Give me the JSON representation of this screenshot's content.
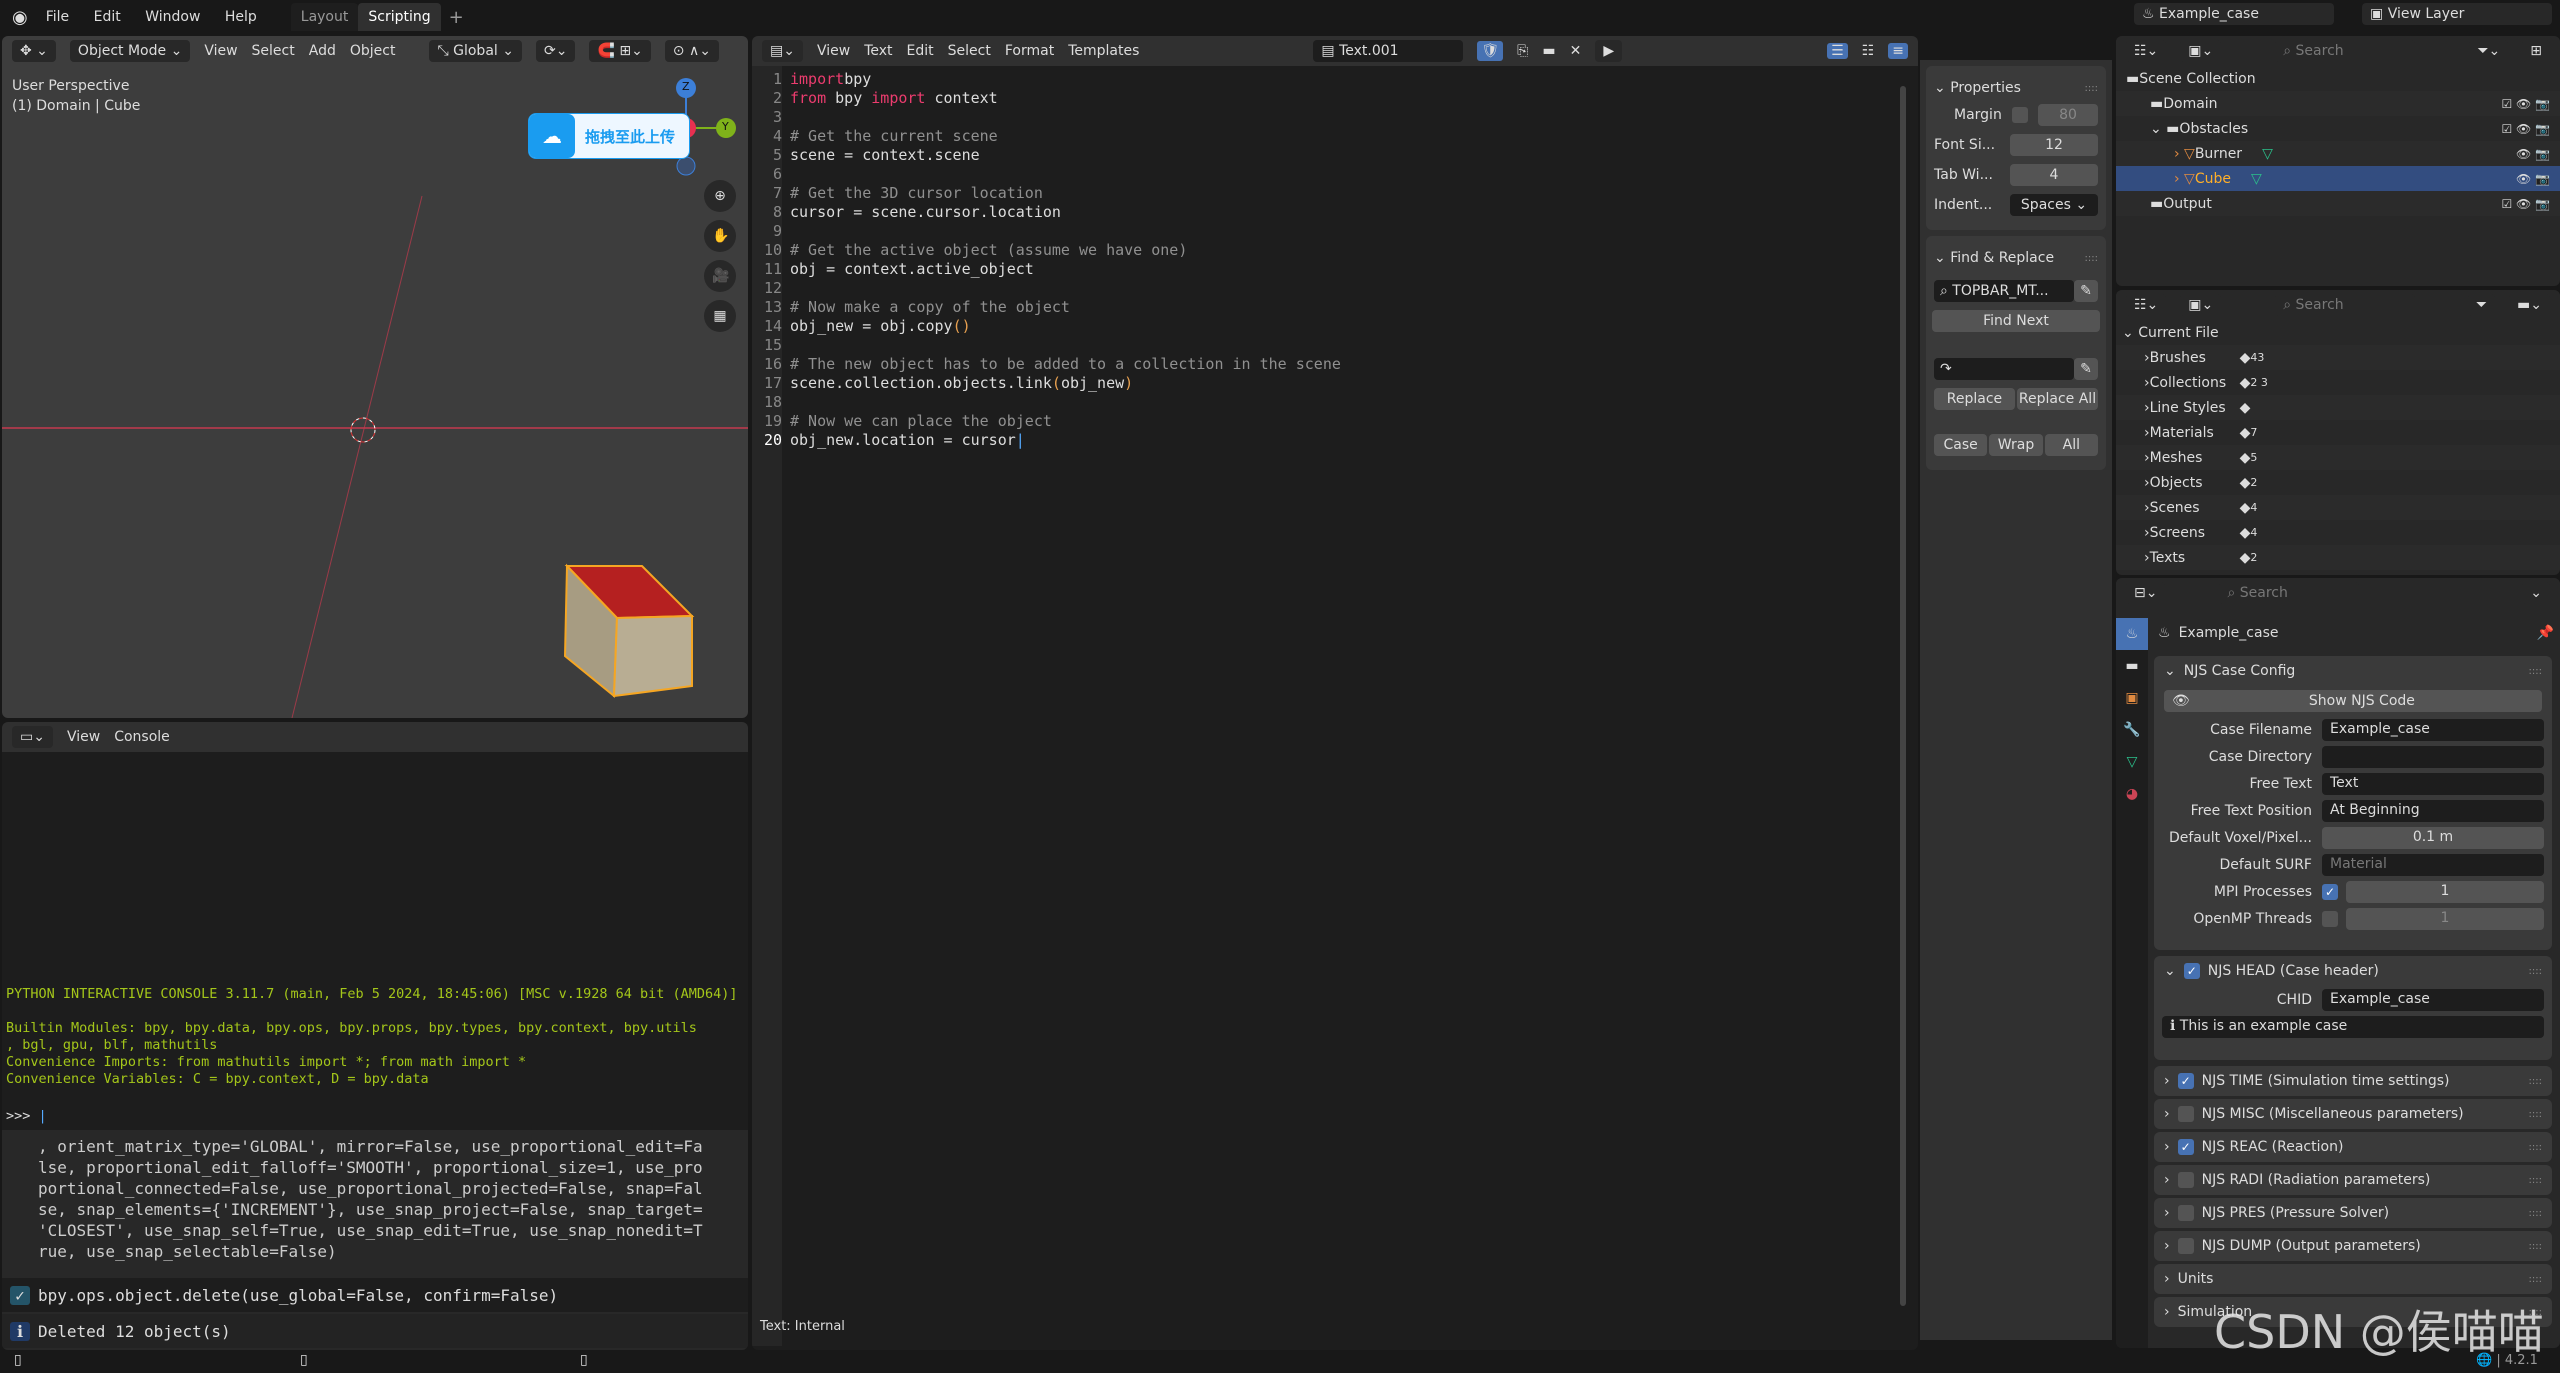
{
  "topbar": {
    "menus": [
      "File",
      "Edit",
      "Window",
      "Help"
    ],
    "tabs": [
      "Layout",
      "Scripting"
    ],
    "add": "+",
    "scene": "Example_case",
    "view_layer": "View Layer"
  },
  "viewport": {
    "mode": "Object Mode",
    "menus": [
      "View",
      "Select",
      "Add",
      "Object"
    ],
    "orientation": "Global",
    "perspective": "User Perspective",
    "context": "(1) Domain | Cube",
    "gizmo": {
      "z": "Z",
      "y": "Y"
    },
    "upload_overlay": "拖拽至此上传",
    "colors": {
      "axis_x": "#c43a4e",
      "axis_y": "#7fb21a",
      "cube_top": "#b52020",
      "cube_side": "#a79c82",
      "selection": "#f5a623"
    }
  },
  "console": {
    "menus": [
      "View",
      "Console"
    ],
    "banner": "PYTHON INTERACTIVE CONSOLE 3.11.7 (main, Feb  5 2024, 18:45:06) [MSC v.1928 64 bit (AMD64)]",
    "lines": [
      "Builtin Modules:       bpy, bpy.data, bpy.ops, bpy.props, bpy.types, bpy.context, bpy.utils",
      ", bgl, gpu, blf, mathutils",
      "Convenience Imports:   from mathutils import *; from math import *",
      "Convenience Variables: C = bpy.context, D = bpy.data"
    ],
    "prompt": ">>> ",
    "report_lines": [
      ", orient_matrix_type='GLOBAL', mirror=False, use_proportional_edit=Fa",
      "lse, proportional_edit_falloff='SMOOTH', proportional_size=1, use_pro",
      "portional_connected=False, use_proportional_projected=False, snap=Fal",
      "se, snap_elements={'INCREMENT'}, use_snap_project=False, snap_target=",
      "'CLOSEST', use_snap_self=True, use_snap_edit=True, use_snap_nonedit=T",
      "rue, use_snap_selectable=False)"
    ],
    "op": "bpy.ops.object.delete(use_global=False, confirm=False)",
    "info": "Deleted 12 object(s)"
  },
  "text_editor": {
    "menus": [
      "View",
      "Text",
      "Edit",
      "Select",
      "Format",
      "Templates"
    ],
    "text_name": "Text.001",
    "status": "Text: Internal",
    "code": [
      [
        [
          "kw",
          "import"
        ],
        [
          "",
          "bpy"
        ]
      ],
      [
        [
          "kw",
          "from"
        ],
        [
          "",
          " bpy "
        ],
        [
          "kw",
          "import"
        ],
        [
          "",
          " context"
        ]
      ],
      [],
      [
        [
          "cm",
          "# Get the current scene"
        ]
      ],
      [
        [
          "",
          "scene = context.scene"
        ]
      ],
      [],
      [
        [
          "cm",
          "# Get the 3D cursor location"
        ]
      ],
      [
        [
          "",
          "cursor = scene.cursor.location"
        ]
      ],
      [],
      [
        [
          "cm",
          "# Get the active object (assume we have one)"
        ]
      ],
      [
        [
          "",
          "obj = context.active_object"
        ]
      ],
      [],
      [
        [
          "cm",
          "# Now make a copy of the object"
        ]
      ],
      [
        [
          "",
          "obj_new = obj.copy"
        ],
        [
          "str",
          "()"
        ]
      ],
      [],
      [
        [
          "cm",
          "# The new object has to be added to a collection in the scene"
        ]
      ],
      [
        [
          "",
          "scene.collection.objects.link"
        ],
        [
          "str",
          "("
        ],
        [
          "",
          "obj_new"
        ],
        [
          "str",
          ")"
        ]
      ],
      [],
      [
        [
          "cm",
          "# Now we can place the object"
        ]
      ],
      [
        [
          "",
          "obj_new.location = cursor"
        ]
      ]
    ],
    "sidebar": {
      "properties_title": "Properties",
      "margin_label": "Margin",
      "margin": "80",
      "font_size_label": "Font Si...",
      "font_size": "12",
      "tab_width_label": "Tab Wi...",
      "tab_width": "4",
      "indent_label": "Indent...",
      "indent": "Spaces",
      "find_title": "Find & Replace",
      "find_value": "TOPBAR_MT...",
      "find_next": "Find Next",
      "replace": "Replace",
      "replace_all": "Replace All",
      "case": "Case",
      "wrap": "Wrap",
      "all": "All"
    }
  },
  "outliner": {
    "search_placeholder": "Search",
    "items": [
      {
        "name": "Scene Collection",
        "depth": 0
      },
      {
        "name": "Domain",
        "depth": 1,
        "check": true
      },
      {
        "name": "Obstacles",
        "depth": 1,
        "check": true,
        "expanded": true
      },
      {
        "name": "Burner",
        "depth": 2,
        "object": true
      },
      {
        "name": "Cube",
        "depth": 2,
        "object": true,
        "selected": true
      },
      {
        "name": "Output",
        "depth": 1,
        "check": true
      }
    ]
  },
  "blend_file": {
    "search_placeholder": "Search",
    "root": "Current File",
    "items": [
      {
        "name": "Brushes",
        "count": "43"
      },
      {
        "name": "Collections",
        "count": "2 3"
      },
      {
        "name": "Line Styles",
        "count": ""
      },
      {
        "name": "Materials",
        "count": "7"
      },
      {
        "name": "Meshes",
        "count": "5"
      },
      {
        "name": "Objects",
        "count": "2"
      },
      {
        "name": "Scenes",
        "count": "4"
      },
      {
        "name": "Screens",
        "count": "4"
      },
      {
        "name": "Texts",
        "count": "2"
      }
    ]
  },
  "properties": {
    "search_placeholder": "Search",
    "scene_name": "Example_case",
    "config_title": "NJS Case Config",
    "show_code": "Show NJS Code",
    "fields": [
      {
        "label": "Case Filename",
        "value": "Example_case"
      },
      {
        "label": "Case Directory",
        "value": ""
      },
      {
        "label": "Free Text",
        "value": "Text"
      },
      {
        "label": "Free Text Position",
        "value": "At Beginning"
      },
      {
        "label": "Default Voxel/Pixel...",
        "value": "0.1 m"
      },
      {
        "label": "Default SURF",
        "value": "Material"
      },
      {
        "label": "MPI Processes",
        "value": "1",
        "checked": true
      },
      {
        "label": "OpenMP Threads",
        "value": "1",
        "checked": false
      }
    ],
    "head": {
      "title": "NJS HEAD (Case header)",
      "checked": true,
      "chid_label": "CHID",
      "chid": "Example_case",
      "info": "This is an example case"
    },
    "sections": [
      {
        "title": "NJS TIME (Simulation time settings)",
        "checked": true
      },
      {
        "title": "NJS MISC (Miscellaneous parameters)",
        "checked": false
      },
      {
        "title": "NJS REAC (Reaction)",
        "checked": true
      },
      {
        "title": "NJS RADI (Radiation parameters)",
        "checked": false
      },
      {
        "title": "NJS PRES (Pressure Solver)",
        "checked": false
      },
      {
        "title": "NJS DUMP (Output parameters)",
        "checked": false
      }
    ],
    "other_panels": [
      "Units",
      "Simulation"
    ]
  },
  "statusbar": {
    "version": "4.2.1"
  },
  "watermark": "CSDN @侯喵喵"
}
